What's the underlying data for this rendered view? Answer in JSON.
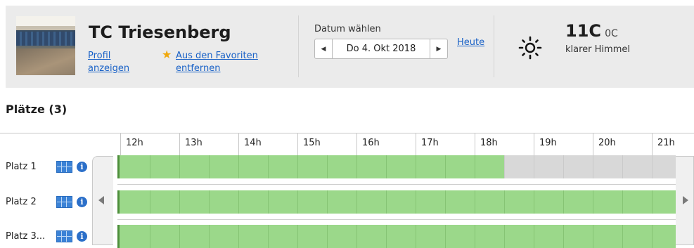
{
  "club": {
    "name": "TC Triesenberg",
    "profile_link": "Profil anzeigen",
    "favorite_link": "Aus den Favoriten entfernen"
  },
  "date": {
    "label": "Datum wählen",
    "value": "Do 4. Okt 2018",
    "today": "Heute"
  },
  "weather": {
    "temp": "11C",
    "temp_low": "0C",
    "description": "klarer Himmel",
    "icon": "sun-icon"
  },
  "courts_title": "Plätze (3)",
  "hours": [
    "12h",
    "13h",
    "14h",
    "15h",
    "16h",
    "17h",
    "18h",
    "19h",
    "20h",
    "21h"
  ],
  "courts": [
    {
      "name": "Platz 1",
      "booked_from_hour": 18.5
    },
    {
      "name": "Platz 2",
      "booked_from_hour": null
    },
    {
      "name": "Platz 3...",
      "booked_from_hour": null
    }
  ],
  "colors": {
    "free_slot": "#9bd88a",
    "booked_slot": "#d8d8d8",
    "link": "#1a62c7",
    "header_bg": "#ebebeb"
  }
}
